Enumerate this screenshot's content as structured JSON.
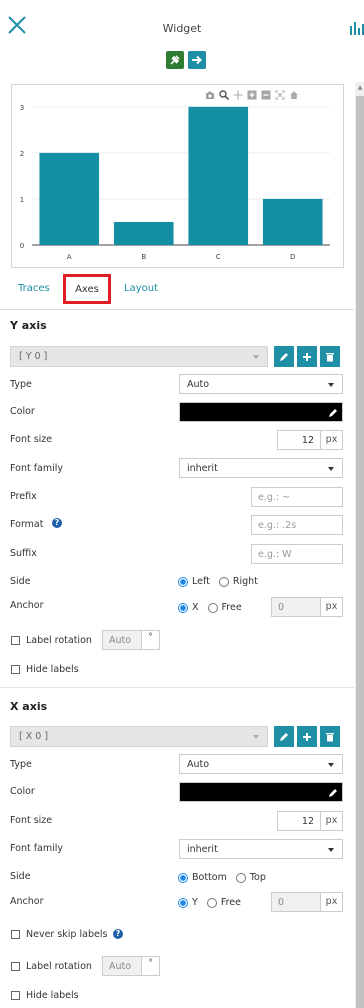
{
  "header": {
    "title": "Widget",
    "close_icon": "close-icon",
    "chart_icon": "bar-chart-icon"
  },
  "header_buttons": [
    {
      "name": "pin-icon",
      "color": "#2e7d32"
    },
    {
      "name": "arrow-right-icon",
      "color": "#1e8fa4"
    }
  ],
  "chart_data": {
    "type": "bar",
    "categories": [
      "A",
      "B",
      "C",
      "D"
    ],
    "values": [
      2,
      0.5,
      3,
      1
    ],
    "ylim": [
      0,
      3.3
    ],
    "yticks": [
      0,
      1,
      2,
      3
    ],
    "color": "#138ea3",
    "title": "",
    "xlabel": "",
    "ylabel": "",
    "grid": true
  },
  "modebar": [
    "camera-icon",
    "zoom-icon",
    "pan-icon",
    "zoom-in-icon",
    "zoom-out-icon",
    "autoscale-icon",
    "home-icon"
  ],
  "tabs": [
    "Traces",
    "Axes",
    "Layout"
  ],
  "yaxis": {
    "heading": "Y axis",
    "selector": "[ Y 0 ]",
    "type_label": "Type",
    "type_value": "Auto",
    "color_label": "Color",
    "color_value": "#000000",
    "fontsize_label": "Font size",
    "fontsize_value": "12",
    "fontsize_unit": "px",
    "fontfamily_label": "Font family",
    "fontfamily_value": "inherit",
    "prefix_label": "Prefix",
    "prefix_placeholder": "e.g.: ~",
    "format_label": "Format",
    "format_placeholder": "e.g.: .2s",
    "suffix_label": "Suffix",
    "suffix_placeholder": "e.g.: W",
    "side_label": "Side",
    "side_opt1": "Left",
    "side_opt2": "Right",
    "side_selected": "Left",
    "anchor_label": "Anchor",
    "anchor_opt1": "X",
    "anchor_opt2": "Free",
    "anchor_selected": "X",
    "anchor_value": "0",
    "anchor_unit": "px",
    "rotation_label": "Label rotation",
    "rotation_value": "Auto",
    "rotation_unit": "°",
    "hide_label": "Hide labels"
  },
  "xaxis": {
    "heading": "X axis",
    "selector": "[ X 0 ]",
    "type_label": "Type",
    "type_value": "Auto",
    "color_label": "Color",
    "color_value": "#000000",
    "fontsize_label": "Font size",
    "fontsize_value": "12",
    "fontsize_unit": "px",
    "fontfamily_label": "Font family",
    "fontfamily_value": "inherit",
    "side_label": "Side",
    "side_opt1": "Bottom",
    "side_opt2": "Top",
    "side_selected": "Bottom",
    "anchor_label": "Anchor",
    "anchor_opt1": "Y",
    "anchor_opt2": "Free",
    "anchor_selected": "Y",
    "anchor_value": "0",
    "anchor_unit": "px",
    "skip_label": "Never skip labels",
    "rotation_label": "Label rotation",
    "rotation_value": "Auto",
    "rotation_unit": "°",
    "hide_label": "Hide labels"
  }
}
